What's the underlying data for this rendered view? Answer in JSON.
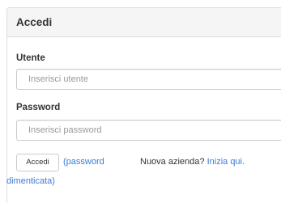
{
  "panel": {
    "title": "Accedi"
  },
  "form": {
    "username": {
      "label": "Utente",
      "placeholder": "Inserisci utente",
      "value": ""
    },
    "password": {
      "label": "Password",
      "placeholder": "Inserisci password",
      "value": ""
    },
    "submit_label": "Accedi",
    "forgot_password": {
      "line1": "(password",
      "line2": "dimenticata)"
    },
    "signup": {
      "prompt": "Nuova azienda?",
      "link": "Inizia qui."
    }
  },
  "colors": {
    "link": "#3a7bd5",
    "heading_bg": "#f5f5f5",
    "border": "#dddddd"
  }
}
